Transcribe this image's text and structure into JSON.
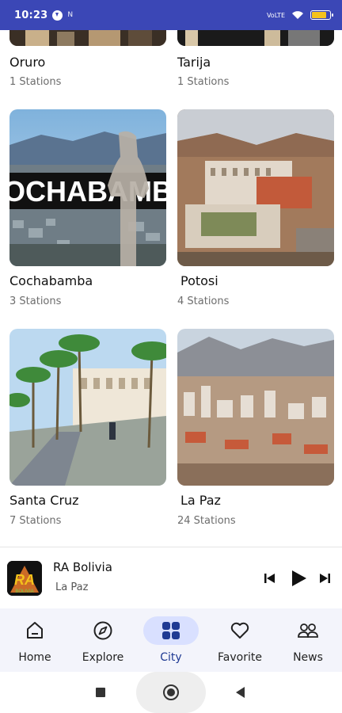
{
  "status_bar": {
    "time": "10:23",
    "small_icon": "N",
    "signal_text": "VoLTE",
    "battery_level": 0.85
  },
  "cities": [
    {
      "name": "Oruro",
      "count": "1 Stations",
      "image": "oruro-photo"
    },
    {
      "name": "Tarija",
      "count": "1 Stations",
      "image": "tarija-photo"
    },
    {
      "name": "Cochabamba",
      "count": "3 Stations",
      "image": "cochabamba-photo",
      "overlay_text": "OCHABAMB"
    },
    {
      "name": "Potosi",
      "count": "4 Stations",
      "image": "potosi-photo"
    },
    {
      "name": "Santa Cruz",
      "count": "7 Stations",
      "image": "santa-cruz-photo"
    },
    {
      "name": "La Paz",
      "count": "24 Stations",
      "image": "la-paz-photo"
    }
  ],
  "player": {
    "title": "RA Bolivia",
    "subtitle": "La Paz",
    "logo_text": "RA",
    "logo_subtext": "BOLIVIA"
  },
  "bottom_nav": {
    "items": [
      {
        "label": "Home",
        "icon": "home-icon"
      },
      {
        "label": "Explore",
        "icon": "compass-icon"
      },
      {
        "label": "City",
        "icon": "grid-icon",
        "active": true
      },
      {
        "label": "Favorite",
        "icon": "heart-icon"
      },
      {
        "label": "News",
        "icon": "people-icon"
      }
    ]
  },
  "colors": {
    "status_bar": "#3b47b6",
    "nav_bg": "#f3f4fb",
    "nav_active_pill": "#d9e0ff",
    "accent": "#1f3a93"
  }
}
